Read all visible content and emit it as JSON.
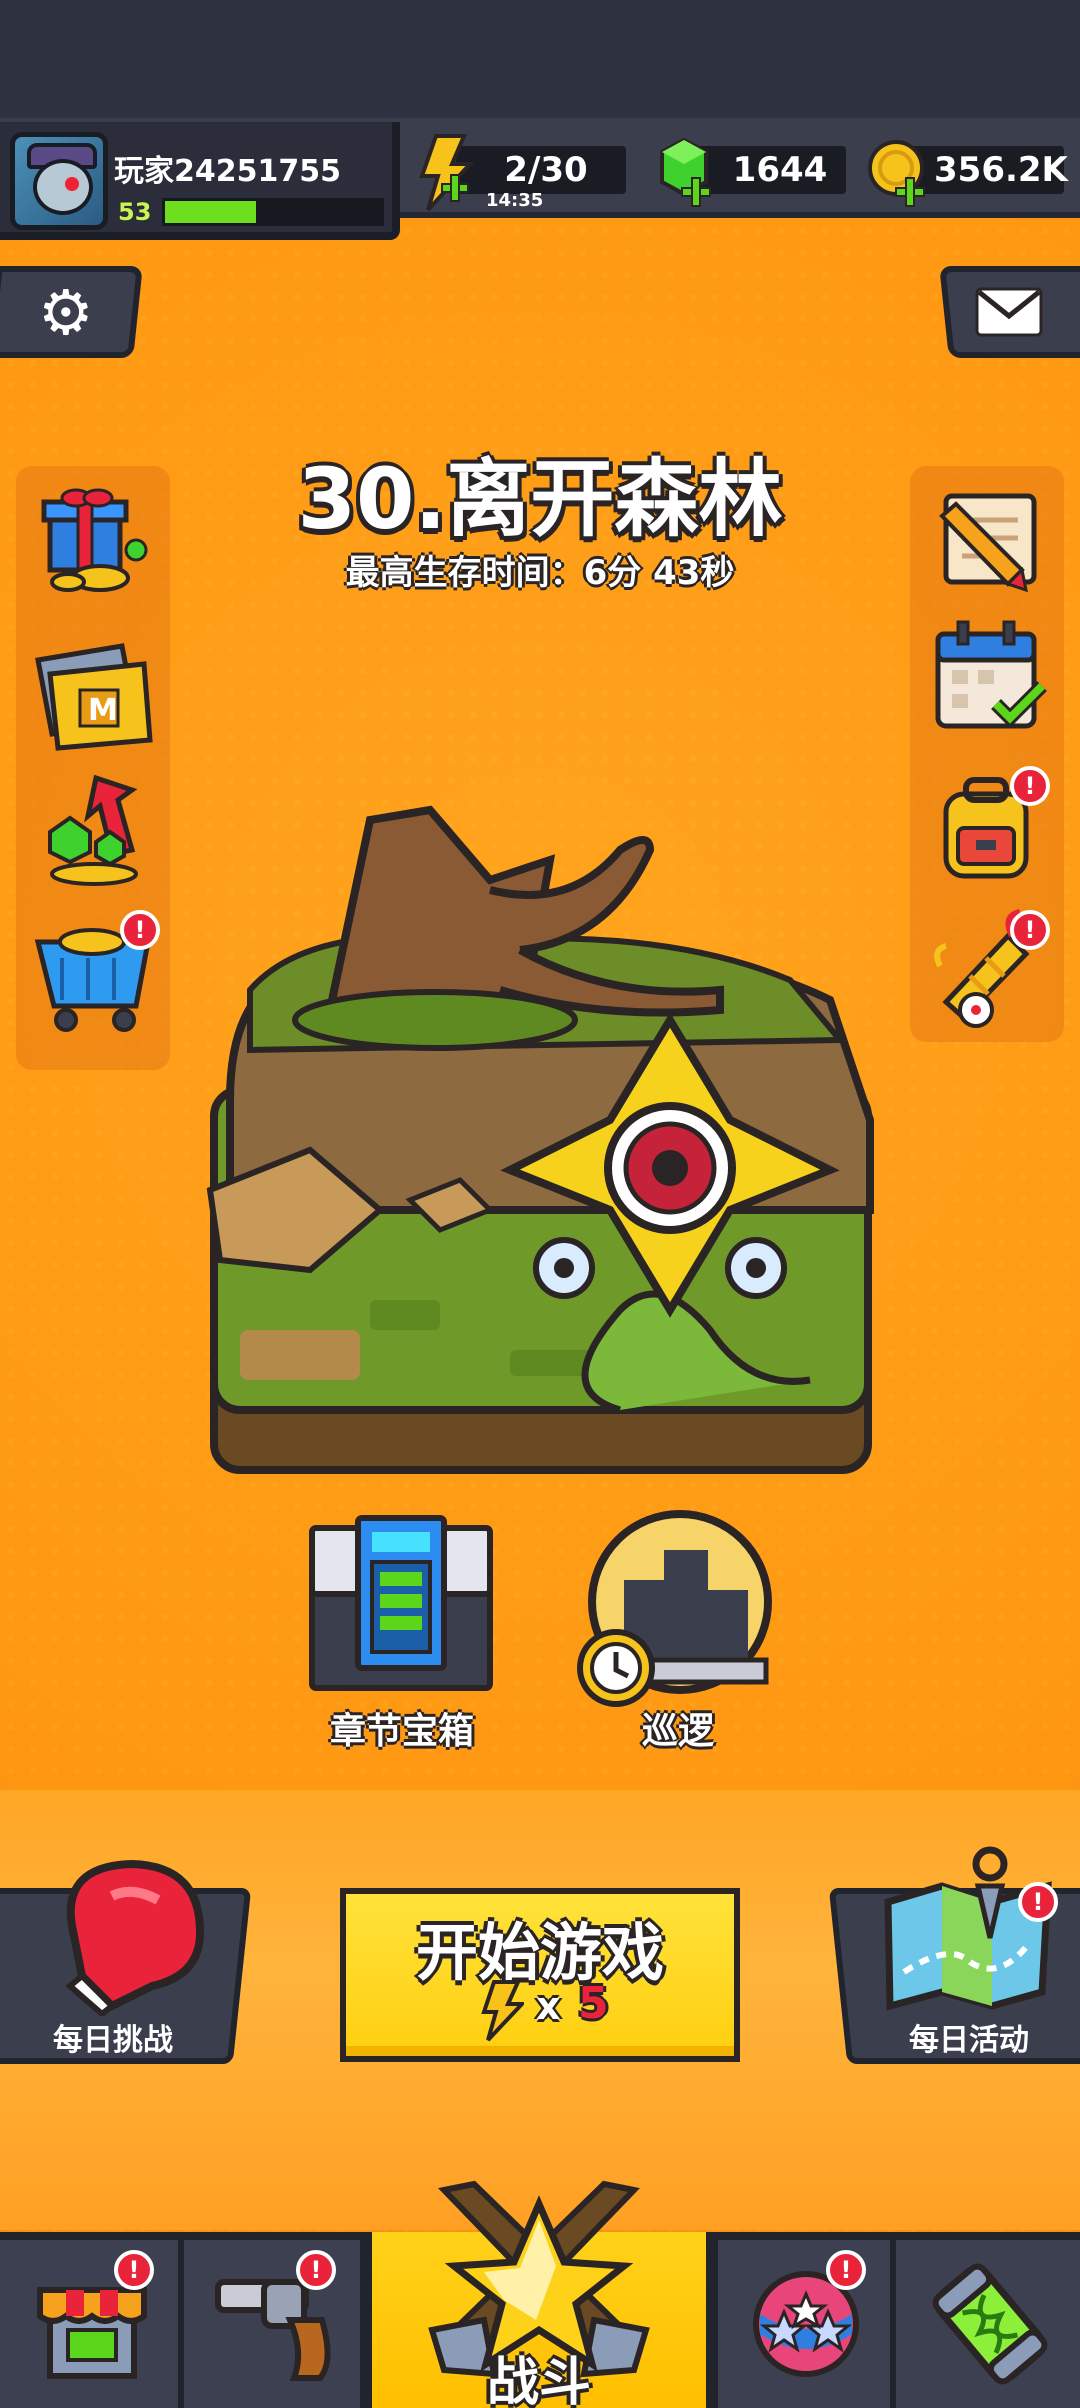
{
  "player": {
    "name": "玩家24251755",
    "level": "53",
    "xp_fraction": 0.42,
    "avatar_icon": "monster-avatar-icon"
  },
  "resources": {
    "energy": {
      "value": "2/30",
      "timer": "14:35",
      "icon": "lightning-icon",
      "color": "#f7c21a"
    },
    "gems": {
      "value": "1644",
      "icon": "green-gem-icon",
      "color": "#3fd12e"
    },
    "coins": {
      "value": "356.2K",
      "icon": "gold-coin-icon",
      "color": "#f6c21c"
    }
  },
  "stage": {
    "title": "30.离开森林",
    "best_time": "最高生存时间：6分 43秒"
  },
  "left_menu": [
    {
      "icon": "gift-coins-icon",
      "badge": ""
    },
    {
      "icon": "monthly-card-icon",
      "badge": ""
    },
    {
      "icon": "gem-growth-icon",
      "badge": ""
    },
    {
      "icon": "shop-cart-icon",
      "badge": "!"
    }
  ],
  "right_menu": [
    {
      "icon": "quest-scroll-icon",
      "badge": ""
    },
    {
      "icon": "calendar-checkin-icon",
      "badge": ""
    },
    {
      "icon": "backpack-icon",
      "badge": "!"
    },
    {
      "icon": "party-horn-icon",
      "badge": "!"
    }
  ],
  "actions": {
    "chapter_chest": "章节宝箱",
    "patrol": "巡逻"
  },
  "bottom_buttons": {
    "daily_challenge": "每日挑战",
    "start_game": "开始游戏",
    "start_cost_multiplier": "x",
    "start_cost": "5",
    "daily_event": "每日活动",
    "daily_event_badge": "!"
  },
  "nav": {
    "shop_badge": "!",
    "weapons_badge": "!",
    "battle_label": "战斗",
    "talents_badge": "!"
  },
  "colors": {
    "background": "#ff9a16",
    "dark_panel": "#3b3f4d",
    "accent_yellow": "#ffd21a",
    "badge_red": "#e8233a"
  }
}
